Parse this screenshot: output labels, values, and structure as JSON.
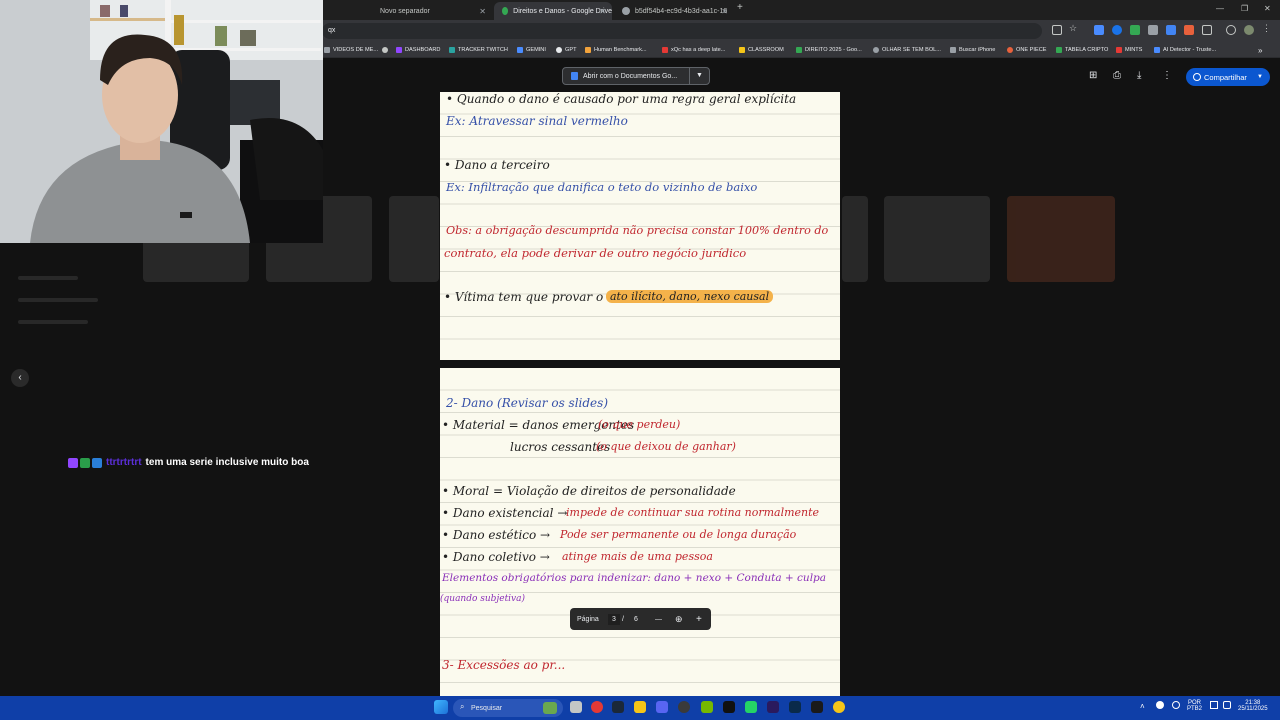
{
  "browser": {
    "tabs": [
      {
        "title": "Novo separador",
        "active": false
      },
      {
        "title": "Direitos e Danos - Google Drive",
        "active": true
      },
      {
        "title": "b5df54b4-ec9d-4b3d-aa1c-16",
        "active": false
      }
    ],
    "new_tab_symbol": "+",
    "close_symbol": "✕",
    "window_controls": {
      "minimize": "—",
      "restore": "❐",
      "close": "✕"
    },
    "address_fragment": "qx",
    "bookmarks": [
      {
        "label": "VIDEOS DE ME...",
        "color": "#9aa0a6"
      },
      {
        "label": "DASHBOARD",
        "color": "#9146ff"
      },
      {
        "label": "TRACKER TWITCH",
        "color": "#2aa3a0"
      },
      {
        "label": "GEMINI",
        "color": "#4a8cff"
      },
      {
        "label": "GPT",
        "color": "#e8eaed"
      },
      {
        "label": "Human Benchmark...",
        "color": "#f2a33c"
      },
      {
        "label": "xQc has a deep late...",
        "color": "#e53935"
      },
      {
        "label": "CLASSROOM",
        "color": "#f5c518"
      },
      {
        "label": "DIREITO 2025 - Goo...",
        "color": "#34a853"
      },
      {
        "label": "OLHAR SE TEM BOL...",
        "color": "#9aa0a6"
      },
      {
        "label": "Buscar iPhone",
        "color": "#9aa0a6"
      },
      {
        "label": "ONE PIECE",
        "color": "#e8613c"
      },
      {
        "label": "TABELA CRIPTO",
        "color": "#34a853"
      },
      {
        "label": "MINTS",
        "color": "#e53935"
      },
      {
        "label": "AI Detector - Truste...",
        "color": "#4a8cff"
      }
    ]
  },
  "viewer": {
    "open_with_label": "Abrir com o Documentos Go...",
    "share_label": "Compartilhar",
    "back_symbol": "‹",
    "page_nav": {
      "label": "Página",
      "current": "3",
      "separator": "/",
      "total": "6",
      "zoom_out": "—",
      "zoom_in": "+"
    }
  },
  "notes": {
    "page1": [
      {
        "text": "• Quando o dano é causado por uma regra geral explícita",
        "color": "black"
      },
      {
        "text": "Ex: Atravessar sinal vermelho",
        "color": "blue"
      },
      {
        "text": "• Dano a terceiro",
        "color": "black"
      },
      {
        "text": "Ex: Infiltração que danifica o teto do vizinho de baixo",
        "color": "blue"
      },
      {
        "text": "Obs: a obrigação descumprida não precisa constar 100% dentro do",
        "color": "red"
      },
      {
        "text": "contrato, ela pode derivar de outro negócio jurídico",
        "color": "red"
      },
      {
        "text": "• Vítima tem que provar o",
        "color": "black"
      },
      {
        "text": "ato ilícito, dano, nexo causal",
        "color": "black"
      }
    ],
    "page2": [
      {
        "text": "2- Dano (Revisar os slides)",
        "color": "blue"
      },
      {
        "text": "• Material = danos emergentes",
        "color": "black"
      },
      {
        "text": "(o que perdeu)",
        "color": "red"
      },
      {
        "text": "lucros cessantes",
        "color": "black"
      },
      {
        "text": "(o que deixou de ganhar)",
        "color": "red"
      },
      {
        "text": "• Moral = Violação de direitos de personalidade",
        "color": "black"
      },
      {
        "text": "• Dano existencial →",
        "color": "black"
      },
      {
        "text": "impede de continuar sua rotina normalmente",
        "color": "red"
      },
      {
        "text": "• Dano estético →",
        "color": "black"
      },
      {
        "text": "Pode ser permanente ou de longa duração",
        "color": "red"
      },
      {
        "text": "• Dano coletivo →",
        "color": "black"
      },
      {
        "text": "atinge mais de uma pessoa",
        "color": "red"
      },
      {
        "text": "Elementos obrigatórios para indenizar: dano + nexo + Conduta + culpa",
        "color": "purple"
      },
      {
        "text": "(quando subjetiva)",
        "color": "purple"
      },
      {
        "text": "3- Excessões ao pr...",
        "color": "red"
      }
    ]
  },
  "chat": {
    "username": "ttrtrtrtrt",
    "message": "tem uma serie inclusive muito boa"
  },
  "taskbar": {
    "search_placeholder": "Pesquisar",
    "language": "POR",
    "keyboard": "PTB2",
    "time": "21:38",
    "date": "25/11/2025"
  }
}
